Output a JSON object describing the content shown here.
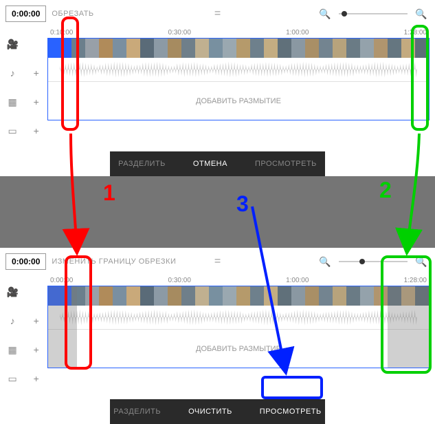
{
  "panel1": {
    "time": "0:00:00",
    "title": "ОБРЕЗАТЬ",
    "ruler": {
      "t0": "0:10:00",
      "t1": "0:30:00",
      "t2": "1:00:00",
      "t3": "1:28:00"
    },
    "blur_label": "ДОБАВИТЬ РАЗМЫТИЕ",
    "buttons": {
      "split": "РАЗДЕЛИТЬ",
      "cancel": "ОТМЕНА",
      "preview": "ПРОСМОТРЕТЬ"
    }
  },
  "panel2": {
    "time": "0:00:00",
    "title": "ИЗМЕНИТЬ ГРАНИЦУ ОБРЕЗКИ",
    "ruler": {
      "t0": "0:00:00",
      "t1": "0:30:00",
      "t2": "1:00:00",
      "t3": "1:28:00"
    },
    "blur_label": "ДОБАВИТЬ РАЗМЫТИЕ",
    "buttons": {
      "split": "РАЗДЕЛИТЬ",
      "clear": "ОЧИСТИТЬ",
      "preview": "ПРОСМОТРЕТЬ"
    }
  },
  "annotations": {
    "one": "1",
    "two": "2",
    "three": "3"
  },
  "thumb_colors": [
    "#6b7f8c",
    "#98a0a8",
    "#b08b5a",
    "#7a8fa0",
    "#c9a97a",
    "#5a6b78",
    "#8c9aa5",
    "#a68b60",
    "#6f7f8a",
    "#c0b090",
    "#7890a0",
    "#9aa8b0",
    "#b59a6b",
    "#6e808c",
    "#c4ad82",
    "#60707a",
    "#8a98a2",
    "#a98f66",
    "#738490",
    "#b7a37c",
    "#6a7b85",
    "#94a2ab",
    "#b0956e",
    "#657680",
    "#c3aa7f",
    "#5d6e78"
  ]
}
